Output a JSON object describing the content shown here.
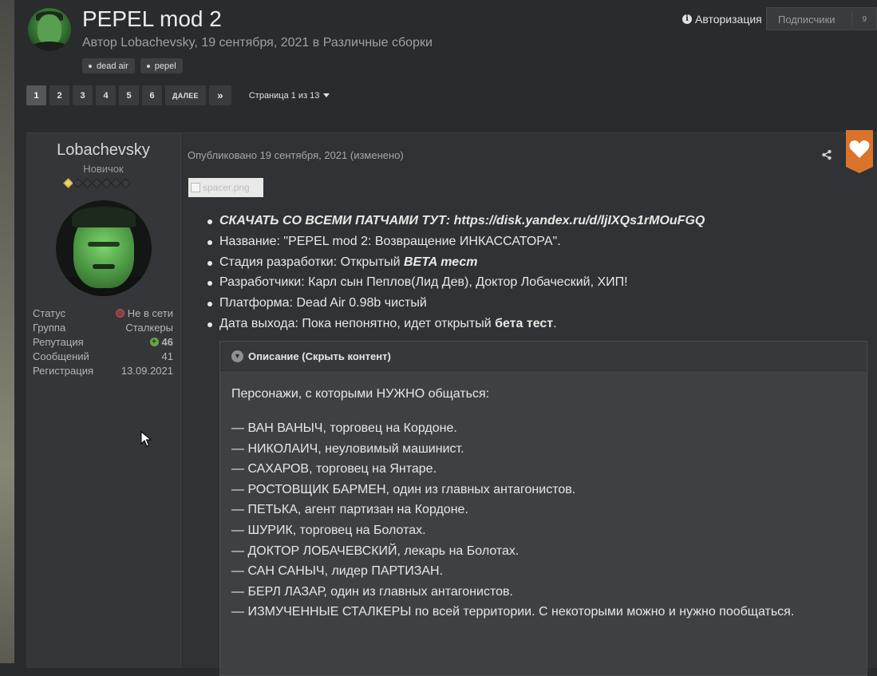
{
  "topic": {
    "title": "PEPEL mod 2",
    "meta_prefix": "Автор ",
    "author": "Lobachevsky",
    "meta_date": ", 19 сентября, 2021 в ",
    "forum": "Различные сборки",
    "tags": [
      "dead air",
      "pepel"
    ]
  },
  "header": {
    "auth_label": "Авторизация",
    "subscribers_label": "Подписчики",
    "subscribers_count": "9"
  },
  "pagination": {
    "pages": [
      "1",
      "2",
      "3",
      "4",
      "5",
      "6"
    ],
    "next_label": "ДАЛЕЕ",
    "last_label": "»",
    "page_info": "Страница 1 из 13"
  },
  "post": {
    "author_name": "Lobachevsky",
    "author_rank": "Новичок",
    "rank_pips_on": 1,
    "rank_pips_total": 7,
    "stats": [
      {
        "key": "Статус",
        "value": "Не в сети"
      },
      {
        "key": "Группа",
        "value": "Сталкеры"
      },
      {
        "key": "Репутация",
        "value": "46"
      },
      {
        "key": "Сообщений",
        "value": "41"
      },
      {
        "key": "Регистрация",
        "value": "13.09.2021"
      }
    ],
    "date_line": "Опубликовано 19 сентября, 2021 (изменено)",
    "spacer_alt": "spacer.png",
    "info": {
      "download": "СКАЧАТЬ СО ВСЕМИ ПАТЧАМИ ТУТ: https://disk.yandex.ru/d/ljIXQs1rMOuFGQ",
      "name": "Название: \"PEPEL mod 2: Возвращение ИНКАССАТОРА\".",
      "stage_prefix": "Стадия разработки: Открытый ",
      "stage_beta": "BETA тест",
      "devs": "Разработчики: Карл сын Пеплов(Лид Дев), Доктор Лобаческий, ХИП!",
      "platform": "Платформа: Dead Air 0.98b чистый",
      "release_prefix": "Дата выхода: Пока непонятно, идет открытый ",
      "release_beta": "бета тест",
      "release_suffix": "."
    },
    "spoiler": {
      "title": "Описание (Скрыть контент)",
      "intro": "Персонажи, с которыми НУЖНО общаться:",
      "lines": [
        "— ВАН ВАНЫЧ, торговец на Кордоне.",
        "— НИКОЛАИЧ, неуловимый машинист.",
        "— САХАРОВ, торговец на Янтаре.",
        "— РОСТОВЩИК БАРМЕН, один из главных антагонистов.",
        "— ПЕТЬКА, агент партизан на Кордоне.",
        "— ШУРИК, торговец на Болотах.",
        "— ДОКТОР ЛОБАЧЕВСКИЙ, лекарь на Болотах.",
        "— САН САНЫЧ, лидер ПАРТИЗАН.",
        "— БЕРЛ ЛАЗАР,  один из главных антагонистов.",
        "— ИЗМУЧЕННЫЕ СТАЛКЕРЫ по всей территории. С некоторыми можно и нужно пообщаться."
      ]
    }
  },
  "colors": {
    "background": "#2a2b2d",
    "like_badge": "#d9742a",
    "reputation": "#7fb34a",
    "offline": "#8b3e3e"
  },
  "icons": [
    "info-icon",
    "caret-down-icon",
    "share-icon",
    "heart-icon",
    "chevron-down-icon",
    "offline-status-icon",
    "plus-icon",
    "broken-image-icon",
    "mouse-cursor-icon"
  ]
}
